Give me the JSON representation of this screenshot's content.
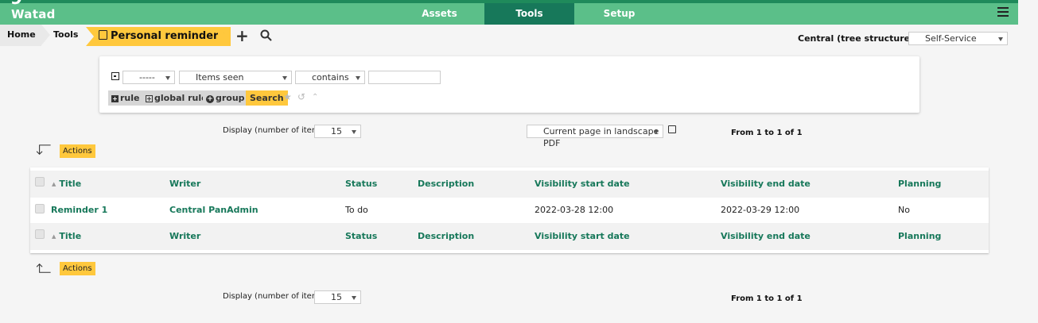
{
  "app": {
    "logo_mark": "9",
    "name": "Watad"
  },
  "topnav": {
    "tabs": [
      {
        "label": "Assets"
      },
      {
        "label": "Tools",
        "active": true
      },
      {
        "label": "Setup"
      }
    ]
  },
  "breadcrumb": {
    "home": "Home",
    "tools": "Tools",
    "current": "Personal reminders"
  },
  "scope": {
    "label": "Central (tree structure)",
    "selected": "Self-Service"
  },
  "filter": {
    "field1": "-----",
    "field2": "Items seen",
    "operator": "contains",
    "value": "",
    "rule_label": "rule",
    "global_rule_label": "global rule",
    "group_label": "group",
    "search_label": "Search"
  },
  "pagination": {
    "display_label": "Display (number of items)",
    "display_value": "15",
    "export_option": "Current page in landscape PDF",
    "range_text": "From 1 to 1 of 1"
  },
  "actions_label": "Actions",
  "table": {
    "columns": [
      "Title",
      "Writer",
      "Status",
      "Description",
      "Visibility start date",
      "Visibility end date",
      "Planning"
    ],
    "rows": [
      {
        "title": "Reminder 1",
        "writer": "Central PanAdmin",
        "status": "To do",
        "description": "",
        "start": "2022-03-28 12:00",
        "end": "2022-03-29 12:00",
        "planning": "No"
      }
    ]
  },
  "colors": {
    "header_green": "#5bbf89",
    "active_tab": "#17785a",
    "accent_yellow": "#ffc83d",
    "link_green": "#17785a"
  }
}
